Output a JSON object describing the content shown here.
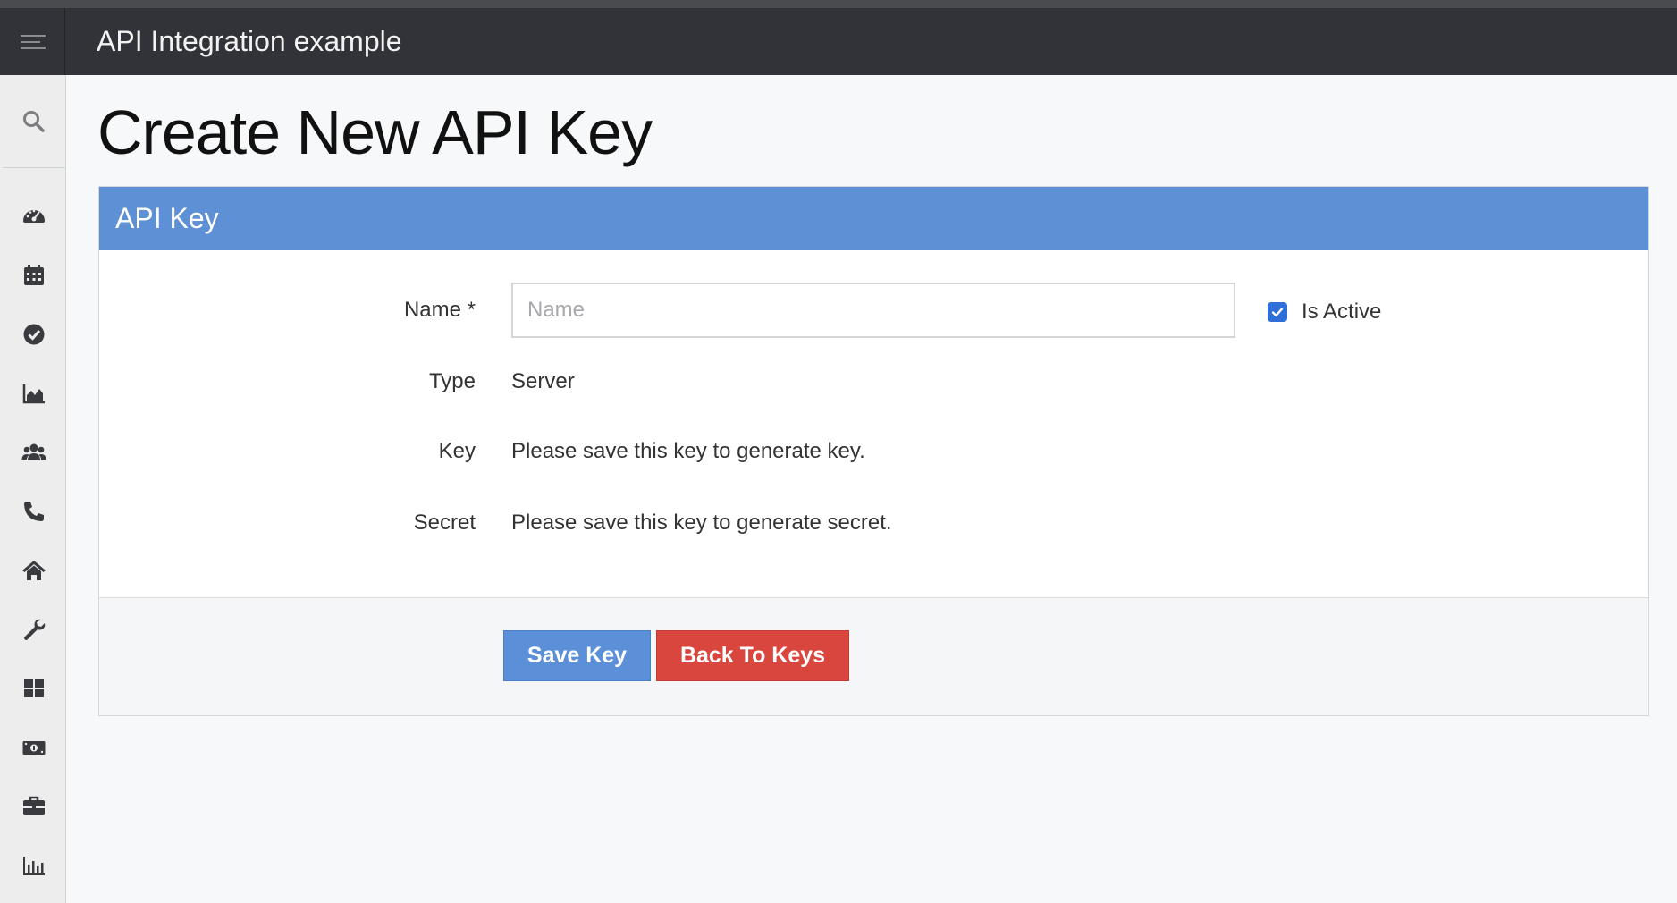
{
  "app": {
    "title": "API Integration example"
  },
  "page": {
    "title": "Create New API Key"
  },
  "panel": {
    "title": "API Key",
    "fields": {
      "name_label": "Name *",
      "name_value": "",
      "name_placeholder": "Name",
      "is_active_label": "Is Active",
      "is_active_checked": true,
      "type_label": "Type",
      "type_value": "Server",
      "key_label": "Key",
      "key_value": "Please save this key to generate key.",
      "secret_label": "Secret",
      "secret_value": "Please save this key to generate secret."
    },
    "buttons": {
      "save_label": "Save Key",
      "back_label": "Back To Keys"
    }
  },
  "sidebar": {
    "items": [
      {
        "icon": "dashboard-gauge-icon"
      },
      {
        "icon": "calendar-icon"
      },
      {
        "icon": "check-circle-icon"
      },
      {
        "icon": "area-chart-icon"
      },
      {
        "icon": "users-icon"
      },
      {
        "icon": "phone-icon"
      },
      {
        "icon": "home-icon"
      },
      {
        "icon": "wrench-icon"
      },
      {
        "icon": "grid-icon"
      },
      {
        "icon": "money-icon"
      },
      {
        "icon": "briefcase-icon"
      },
      {
        "icon": "bar-chart-icon"
      }
    ]
  },
  "colors": {
    "topbar": "#323338",
    "accent": "#5e90d6",
    "save": "#5b8fd7",
    "back": "#d9463e",
    "checkbox": "#2f6fd8"
  }
}
